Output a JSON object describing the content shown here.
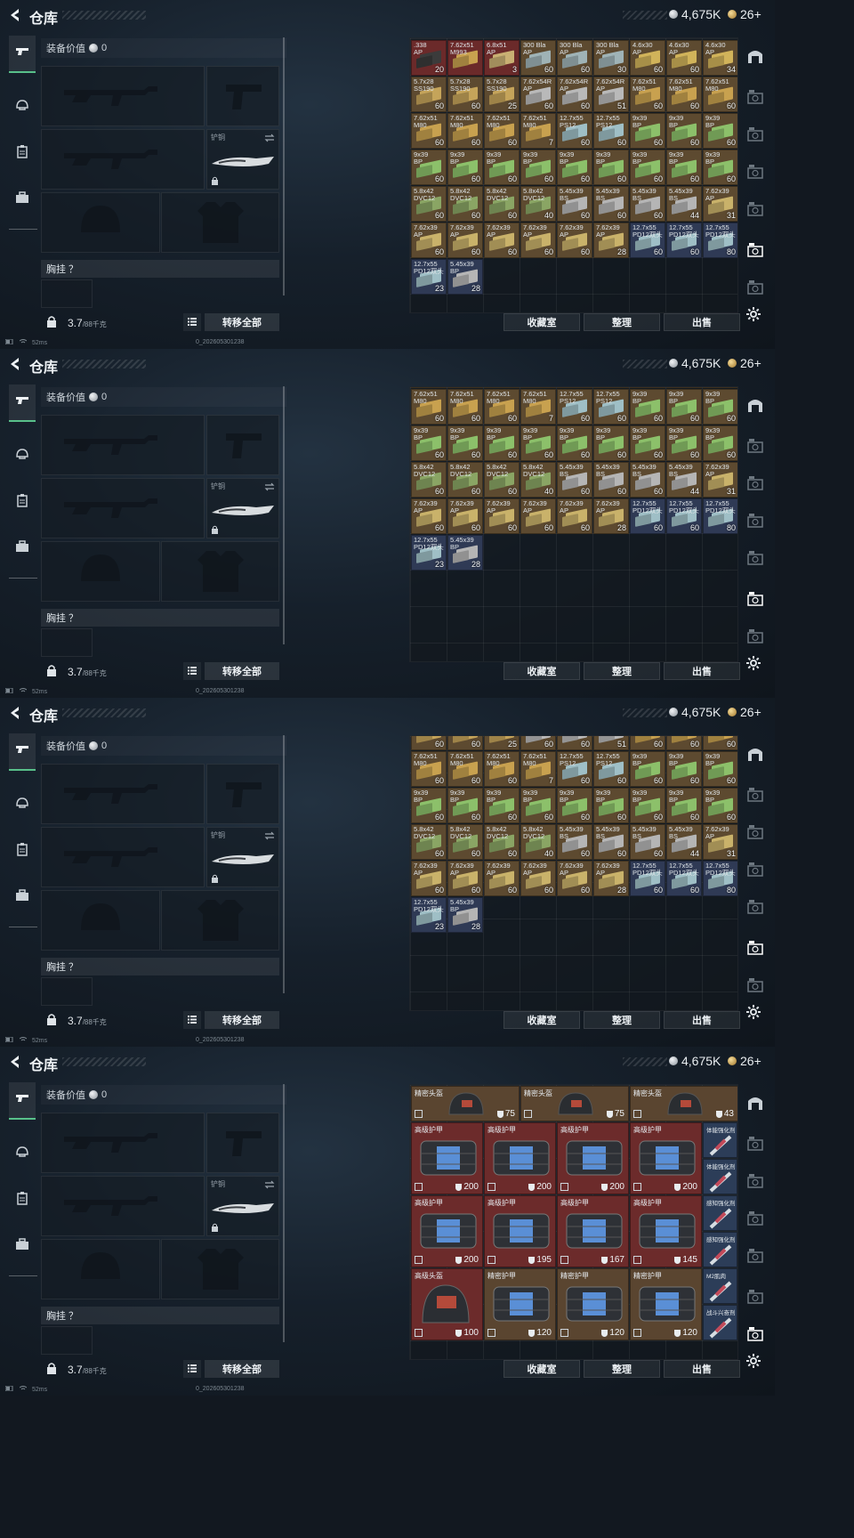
{
  "app": {
    "title": "仓库",
    "silver": "4,675K",
    "gold": "26+",
    "equip_value_label": "装备价值",
    "equip_value": "0",
    "melee_label": "铲铜",
    "chest_label": "胸挂 ？",
    "weight": "3.7",
    "weight_max": "/88千克",
    "transfer_all": "转移全部",
    "btn_collection": "收藏室",
    "btn_sort": "整理",
    "btn_sell": "出售",
    "ping": "52ms",
    "build": "0_202605301238"
  },
  "colors": {
    "accent_green": "#58c08a",
    "ammo_red": "#6b2a2a",
    "ammo_brown": "#5d4a30",
    "ammo_blue": "#2f3a55",
    "gear_red": "#6c2b2b",
    "gear_brown": "#5a4530",
    "gear_blue": "#2c3d58"
  },
  "icons": [
    "back-arrow-icon",
    "silver-coin-icon",
    "gold-coin-icon",
    "pistol-icon",
    "helmet-icon",
    "clipboard-icon",
    "briefcase-icon",
    "lock-icon",
    "list-icon",
    "swap-icon",
    "gear-icon",
    "camera-icon",
    "tv-icon"
  ],
  "ammo_rows": [
    [
      {
        "n": ".338",
        "n2": "AP",
        "c": "20",
        "t": "red"
      },
      {
        "n": "7.62x51",
        "n2": "M993",
        "c": "",
        "t": "red"
      },
      {
        "n": "6.8x51",
        "n2": "AP",
        "c": "3",
        "t": "red"
      },
      {
        "n": "300 Bla",
        "n2": "AP",
        "c": "60",
        "t": "brown"
      },
      {
        "n": "300 Bla",
        "n2": "AP",
        "c": "60",
        "t": "brown"
      },
      {
        "n": "300 Bla",
        "n2": "AP",
        "c": "30",
        "t": "brown"
      },
      {
        "n": "4.6x30",
        "n2": "AP",
        "c": "60",
        "t": "brown"
      },
      {
        "n": "4.6x30",
        "n2": "AP",
        "c": "60",
        "t": "brown"
      },
      {
        "n": "4.6x30",
        "n2": "AP",
        "c": "34",
        "t": "brown"
      }
    ],
    [
      {
        "n": "5.7x28",
        "n2": "SS190",
        "c": "60",
        "t": "brown"
      },
      {
        "n": "5.7x28",
        "n2": "SS190",
        "c": "60",
        "t": "brown"
      },
      {
        "n": "5.7x28",
        "n2": "SS190",
        "c": "25",
        "t": "brown"
      },
      {
        "n": "7.62x54R",
        "n2": "AP",
        "c": "60",
        "t": "brown"
      },
      {
        "n": "7.62x54R",
        "n2": "AP",
        "c": "60",
        "t": "brown"
      },
      {
        "n": "7.62x54R",
        "n2": "AP",
        "c": "51",
        "t": "brown"
      },
      {
        "n": "7.62x51",
        "n2": "M80",
        "c": "60",
        "t": "brown"
      },
      {
        "n": "7.62x51",
        "n2": "M80",
        "c": "60",
        "t": "brown"
      },
      {
        "n": "7.62x51",
        "n2": "M80",
        "c": "60",
        "t": "brown"
      }
    ],
    [
      {
        "n": "7.62x51",
        "n2": "M80",
        "c": "60",
        "t": "brown"
      },
      {
        "n": "7.62x51",
        "n2": "M80",
        "c": "60",
        "t": "brown"
      },
      {
        "n": "7.62x51",
        "n2": "M80",
        "c": "60",
        "t": "brown"
      },
      {
        "n": "7.62x51",
        "n2": "M80",
        "c": "7",
        "t": "brown"
      },
      {
        "n": "12.7x55",
        "n2": "PS12",
        "c": "60",
        "t": "brown"
      },
      {
        "n": "12.7x55",
        "n2": "PS12",
        "c": "60",
        "t": "brown"
      },
      {
        "n": "9x39",
        "n2": "BP",
        "c": "60",
        "t": "brown"
      },
      {
        "n": "9x39",
        "n2": "BP",
        "c": "60",
        "t": "brown"
      },
      {
        "n": "9x39",
        "n2": "BP",
        "c": "60",
        "t": "brown"
      }
    ],
    [
      {
        "n": "9x39",
        "n2": "BP",
        "c": "60",
        "t": "brown"
      },
      {
        "n": "9x39",
        "n2": "BP",
        "c": "60",
        "t": "brown"
      },
      {
        "n": "9x39",
        "n2": "BP",
        "c": "60",
        "t": "brown"
      },
      {
        "n": "9x39",
        "n2": "BP",
        "c": "60",
        "t": "brown"
      },
      {
        "n": "9x39",
        "n2": "BP",
        "c": "60",
        "t": "brown"
      },
      {
        "n": "9x39",
        "n2": "BP",
        "c": "60",
        "t": "brown"
      },
      {
        "n": "9x39",
        "n2": "BP",
        "c": "60",
        "t": "brown"
      },
      {
        "n": "9x39",
        "n2": "BP",
        "c": "60",
        "t": "brown"
      },
      {
        "n": "9x39",
        "n2": "BP",
        "c": "60",
        "t": "brown"
      }
    ],
    [
      {
        "n": "5.8x42",
        "n2": "DVC12",
        "c": "60",
        "t": "brown"
      },
      {
        "n": "5.8x42",
        "n2": "DVC12",
        "c": "60",
        "t": "brown"
      },
      {
        "n": "5.8x42",
        "n2": "DVC12",
        "c": "60",
        "t": "brown"
      },
      {
        "n": "5.8x42",
        "n2": "DVC12",
        "c": "40",
        "t": "brown"
      },
      {
        "n": "5.45x39",
        "n2": "BS",
        "c": "60",
        "t": "brown"
      },
      {
        "n": "5.45x39",
        "n2": "BS",
        "c": "60",
        "t": "brown"
      },
      {
        "n": "5.45x39",
        "n2": "BS",
        "c": "60",
        "t": "brown"
      },
      {
        "n": "5.45x39",
        "n2": "BS",
        "c": "44",
        "t": "brown"
      },
      {
        "n": "7.62x39",
        "n2": "AP",
        "c": "31",
        "t": "brown"
      }
    ],
    [
      {
        "n": "7.62x39",
        "n2": "AP",
        "c": "60",
        "t": "brown"
      },
      {
        "n": "7.62x39",
        "n2": "AP",
        "c": "60",
        "t": "brown"
      },
      {
        "n": "7.62x39",
        "n2": "AP",
        "c": "60",
        "t": "brown"
      },
      {
        "n": "7.62x39",
        "n2": "AP",
        "c": "60",
        "t": "brown"
      },
      {
        "n": "7.62x39",
        "n2": "AP",
        "c": "60",
        "t": "brown"
      },
      {
        "n": "7.62x39",
        "n2": "AP",
        "c": "28",
        "t": "brown"
      },
      {
        "n": "12.7x55",
        "n2": "PD12双头",
        "c": "60",
        "t": "blue"
      },
      {
        "n": "12.7x55",
        "n2": "PD12双头",
        "c": "60",
        "t": "blue"
      },
      {
        "n": "12.7x55",
        "n2": "PD12双头",
        "c": "80",
        "t": "blue"
      }
    ],
    [
      {
        "n": "12.7x55",
        "n2": "PD12双头",
        "c": "23",
        "t": "blue"
      },
      {
        "n": "5.45x39",
        "n2": "BP",
        "c": "28",
        "t": "blue"
      }
    ]
  ],
  "gear": {
    "helmets_top": [
      {
        "name": "精密头盔",
        "dur": "75"
      },
      {
        "name": "精密头盔",
        "dur": "75"
      },
      {
        "name": "精密头盔",
        "dur": "43"
      }
    ],
    "armor_rows": [
      [
        {
          "name": "高级护甲",
          "dur": "200"
        },
        {
          "name": "高级护甲",
          "dur": "200"
        },
        {
          "name": "高级护甲",
          "dur": "200"
        },
        {
          "name": "高级护甲",
          "dur": "200"
        }
      ],
      [
        {
          "name": "高级护甲",
          "dur": "200"
        },
        {
          "name": "高级护甲",
          "dur": "195"
        },
        {
          "name": "高级护甲",
          "dur": "167"
        },
        {
          "name": "高级护甲",
          "dur": "145"
        }
      ],
      [
        {
          "name": "高级头盔",
          "dur": "100"
        },
        {
          "name": "精密护甲",
          "dur": "120"
        },
        {
          "name": "精密护甲",
          "dur": "120"
        },
        {
          "name": "精密护甲",
          "dur": "120"
        }
      ]
    ],
    "injectors": [
      {
        "name": "体能强化剂"
      },
      {
        "name": "体能强化剂"
      },
      {
        "name": "感知强化剂"
      },
      {
        "name": "感知强化剂"
      },
      {
        "name": "M2肌肉"
      },
      {
        "name": "战斗兴奋剂"
      }
    ]
  }
}
